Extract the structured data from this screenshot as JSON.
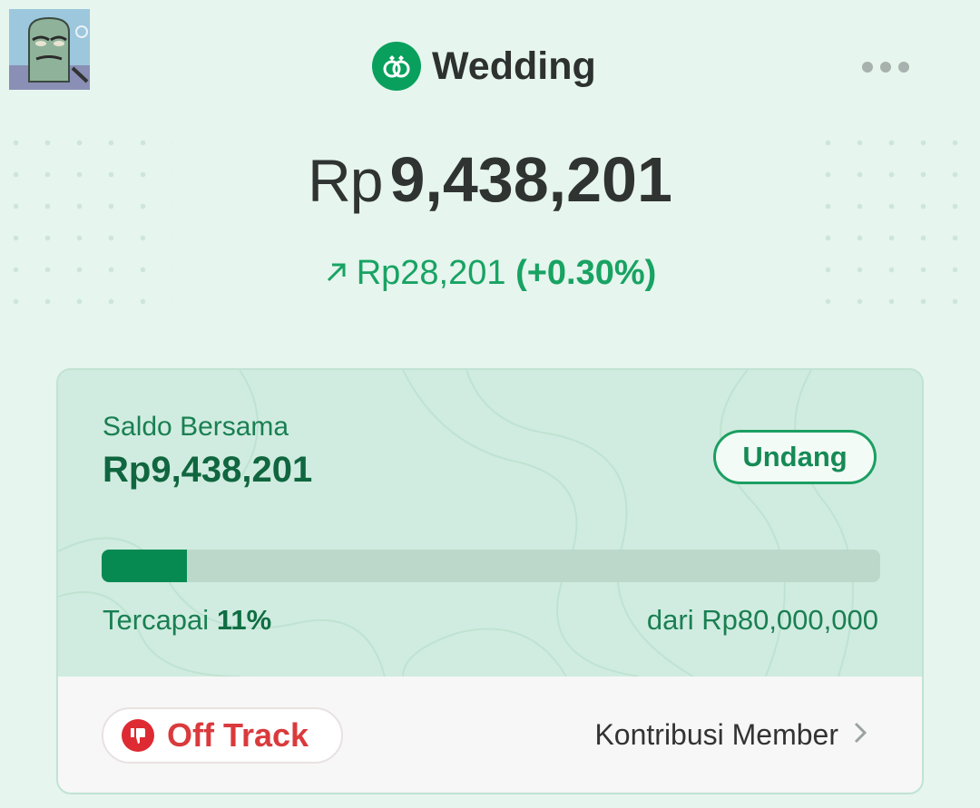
{
  "header": {
    "title": "Wedding",
    "icon": "rings-icon",
    "menu_icon": "more-horizontal-icon",
    "avatar_icon": "avatar-image"
  },
  "balance": {
    "currency": "Rp",
    "amount": "9,438,201"
  },
  "change": {
    "icon": "arrow-up-right-icon",
    "amount": "Rp28,201",
    "percent": "(+0.30%)"
  },
  "card": {
    "saldo_label": "Saldo Bersama",
    "saldo_amount": "Rp9,438,201",
    "invite_label": "Undang",
    "progress_percent": 11,
    "reached_label": "Tercapai",
    "reached_value": "11%",
    "target_label": "dari Rp80,000,000",
    "status_label": "Off Track",
    "status_icon": "thumbs-down-icon",
    "contribution_label": "Kontribusi Member",
    "contribution_icon": "chevron-right-icon"
  },
  "colors": {
    "background": "#e6f5ee",
    "brand_green": "#08a05c",
    "dark_green": "#078a52",
    "status_red": "#de2a32"
  }
}
